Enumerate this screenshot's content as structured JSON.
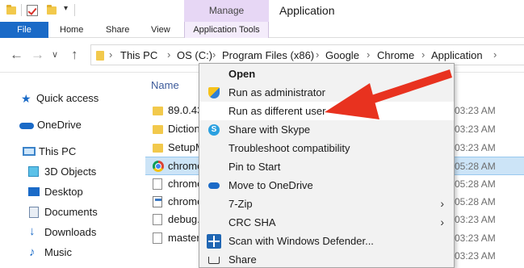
{
  "window": {
    "title": "Application",
    "manage_tab": "Manage"
  },
  "ribbon": {
    "file": "File",
    "home": "Home",
    "share": "Share",
    "view": "View",
    "app_tools": "Application Tools",
    "quick_access_dropdown": "▾"
  },
  "address": {
    "back_glyph": "←",
    "forward_glyph": "→",
    "recent_glyph": "∨",
    "up_glyph": "↑",
    "separator": "›",
    "crumbs": [
      "This PC",
      "OS (C:)",
      "Program Files (x86)",
      "Google",
      "Chrome",
      "Application"
    ]
  },
  "navpane": {
    "items": [
      {
        "label": "Quick access",
        "icon": "star-icon"
      },
      {
        "label": "OneDrive",
        "icon": "cloud-icon"
      },
      {
        "label": "This PC",
        "icon": "computer-icon"
      },
      {
        "label": "3D Objects",
        "icon": "cube-icon"
      },
      {
        "label": "Desktop",
        "icon": "desktop-icon"
      },
      {
        "label": "Documents",
        "icon": "documents-icon"
      },
      {
        "label": "Downloads",
        "icon": "download-icon"
      },
      {
        "label": "Music",
        "icon": "music-icon"
      }
    ]
  },
  "files": {
    "name_header": "Name",
    "rows": [
      {
        "name": "89.0.43",
        "date": "03:23 AM",
        "icon": "folder-icon"
      },
      {
        "name": "Diction",
        "date": "03:23 AM",
        "icon": "folder-icon"
      },
      {
        "name": "SetupM",
        "date": "03:23 AM",
        "icon": "folder-icon"
      },
      {
        "name": "chrome",
        "date": "05:28 AM",
        "icon": "chrome-icon"
      },
      {
        "name": "chrome",
        "date": "05:28 AM",
        "icon": "file-icon"
      },
      {
        "name": "chrome",
        "date": "05:28 AM",
        "icon": "app-icon"
      },
      {
        "name": "debug.",
        "date": "03:23 AM",
        "icon": "file-icon"
      },
      {
        "name": "master",
        "date": "03:23 AM",
        "icon": "file-icon"
      },
      {
        "name": "",
        "date": "03:23 AM",
        "icon": ""
      }
    ]
  },
  "context_menu": {
    "submenu_glyph": "›",
    "items": [
      {
        "label": "Open",
        "bold": true
      },
      {
        "label": "Run as administrator",
        "icon": "shield-icon"
      },
      {
        "label": "Run as different user",
        "highlighted": true
      },
      {
        "label": "Share with Skype",
        "icon": "skype-icon"
      },
      {
        "label": "Troubleshoot compatibility"
      },
      {
        "label": "Pin to Start"
      },
      {
        "label": "Move to OneDrive",
        "icon": "onedrive-icon"
      },
      {
        "label": "7-Zip",
        "submenu": true
      },
      {
        "label": "CRC SHA",
        "submenu": true
      },
      {
        "label": "Scan with Windows Defender...",
        "icon": "defender-icon"
      },
      {
        "label": "Share",
        "icon": "share-icon"
      }
    ]
  },
  "colors": {
    "accent": "#1a6ac7",
    "manage_tab": "#e7d7f5",
    "annotation_arrow": "#e8321f",
    "selection": "#cce4f7"
  }
}
